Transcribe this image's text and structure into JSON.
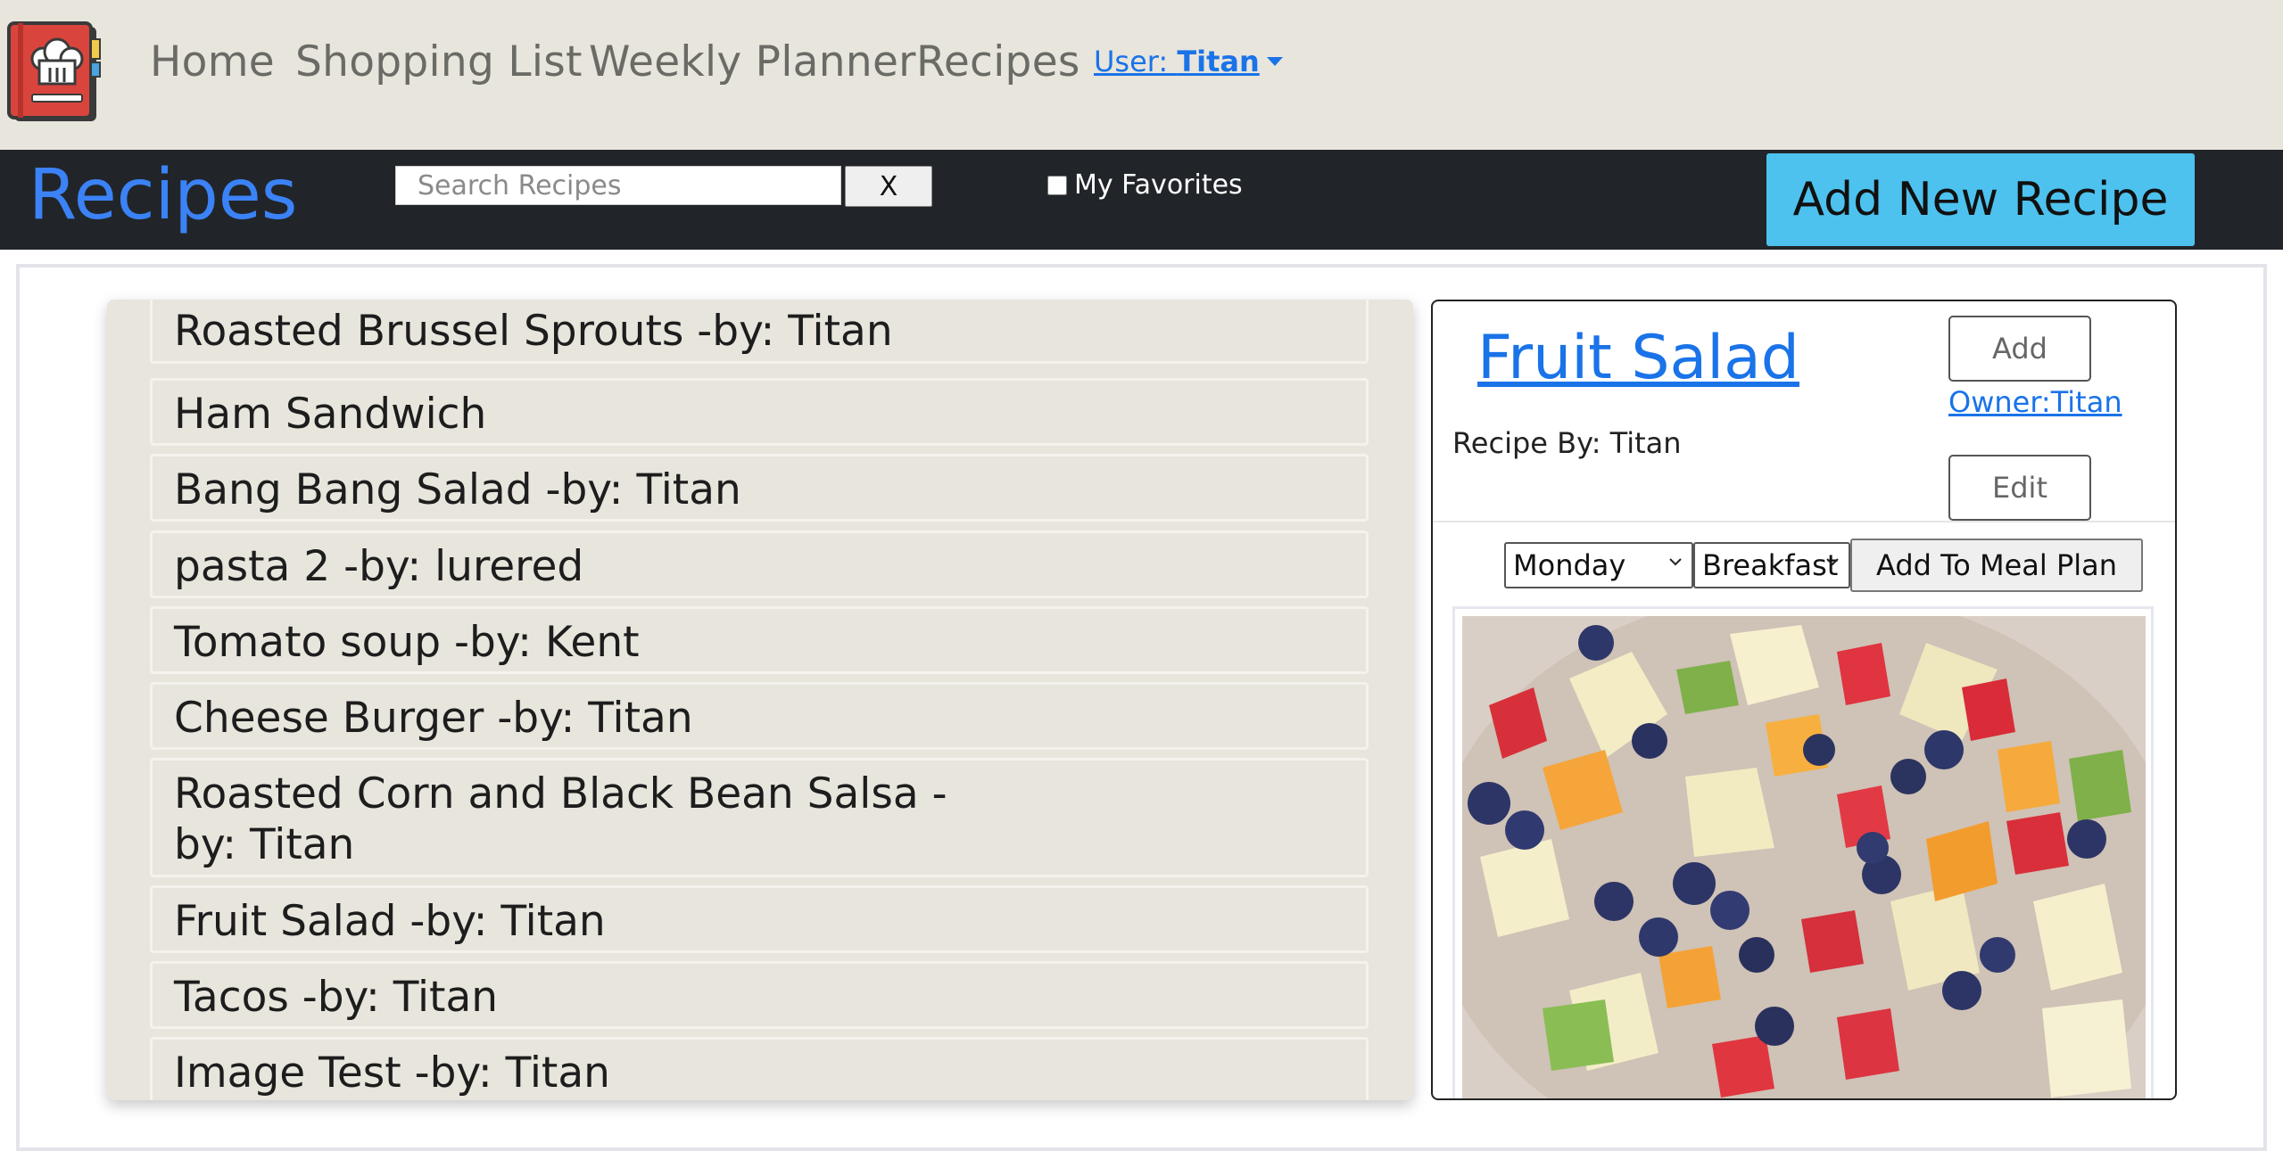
{
  "nav": {
    "links": [
      "Home",
      "Shopping List",
      "Weekly Planner",
      "Recipes"
    ],
    "user_prefix": "User: ",
    "user_name": "Titan"
  },
  "toolbar": {
    "title": "Recipes",
    "search_placeholder": "Search Recipes",
    "clear_label": "X",
    "favorites_label": "My Favorites",
    "add_recipe_label": "Add New Recipe"
  },
  "recipes": [
    "Roasted Brussel Sprouts -by: Titan",
    "Ham Sandwich",
    "Bang Bang Salad -by: Titan",
    "pasta 2 -by: lurered",
    "Tomato soup -by: Kent",
    "Cheese Burger -by: Titan",
    "Roasted Corn and Black Bean Salsa -by: Titan",
    "Fruit Salad -by: Titan",
    "Tacos -by: Titan",
    "Image Test -by: Titan"
  ],
  "detail": {
    "title": "Fruit Salad",
    "recipe_by": "Recipe By: Titan",
    "add_label": "Add",
    "owner_label": "Owner:Titan",
    "edit_label": "Edit",
    "day_selected": "Monday",
    "meal_selected": "Breakfast",
    "add_to_plan_label": "Add To Meal Plan"
  },
  "colors": {
    "accent_blue": "#3b82f6",
    "link_blue": "#1a73e8",
    "nav_bg": "#e8e5dd",
    "toolbar_bg": "#212529",
    "add_button_bg": "#4dc2ef"
  },
  "icons": {
    "logo": "chef-hat-book-icon",
    "user_caret": "caret-down-icon",
    "select_chevron": "chevron-down-icon"
  }
}
